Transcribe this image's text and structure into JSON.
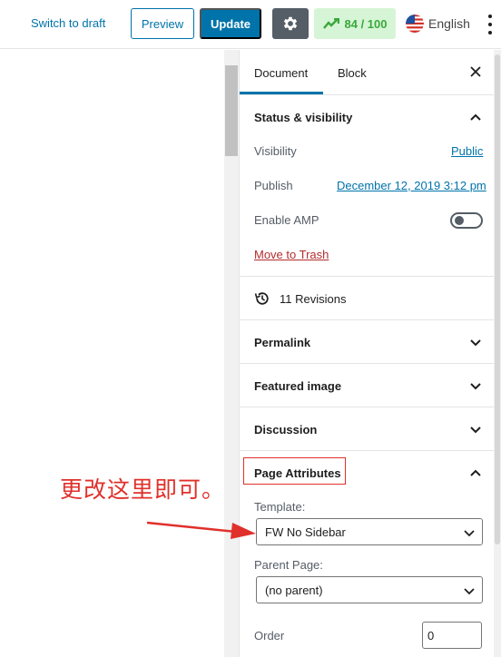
{
  "toolbar": {
    "switch_to_draft": "Switch to draft",
    "preview": "Preview",
    "update": "Update",
    "score": "84 / 100",
    "language": "English"
  },
  "sidebar": {
    "tabs": {
      "document": "Document",
      "block": "Block"
    },
    "status": {
      "title": "Status & visibility",
      "visibility_label": "Visibility",
      "visibility_value": "Public",
      "publish_label": "Publish",
      "publish_value": "December 12, 2019 3:12 pm",
      "amp_label": "Enable AMP",
      "trash": "Move to Trash"
    },
    "revisions": "11 Revisions",
    "panels": {
      "permalink": "Permalink",
      "featured_image": "Featured image",
      "discussion": "Discussion"
    },
    "page_attributes": {
      "title": "Page Attributes",
      "template_label": "Template:",
      "template_value": "FW No Sidebar",
      "parent_label": "Parent Page:",
      "parent_value": "(no parent)",
      "order_label": "Order",
      "order_value": "0"
    }
  },
  "annotation": {
    "text": "更改这里即可。"
  },
  "colors": {
    "accent": "#0073aa",
    "annotation": "#e0302b",
    "score_green": "#3aa83a"
  }
}
